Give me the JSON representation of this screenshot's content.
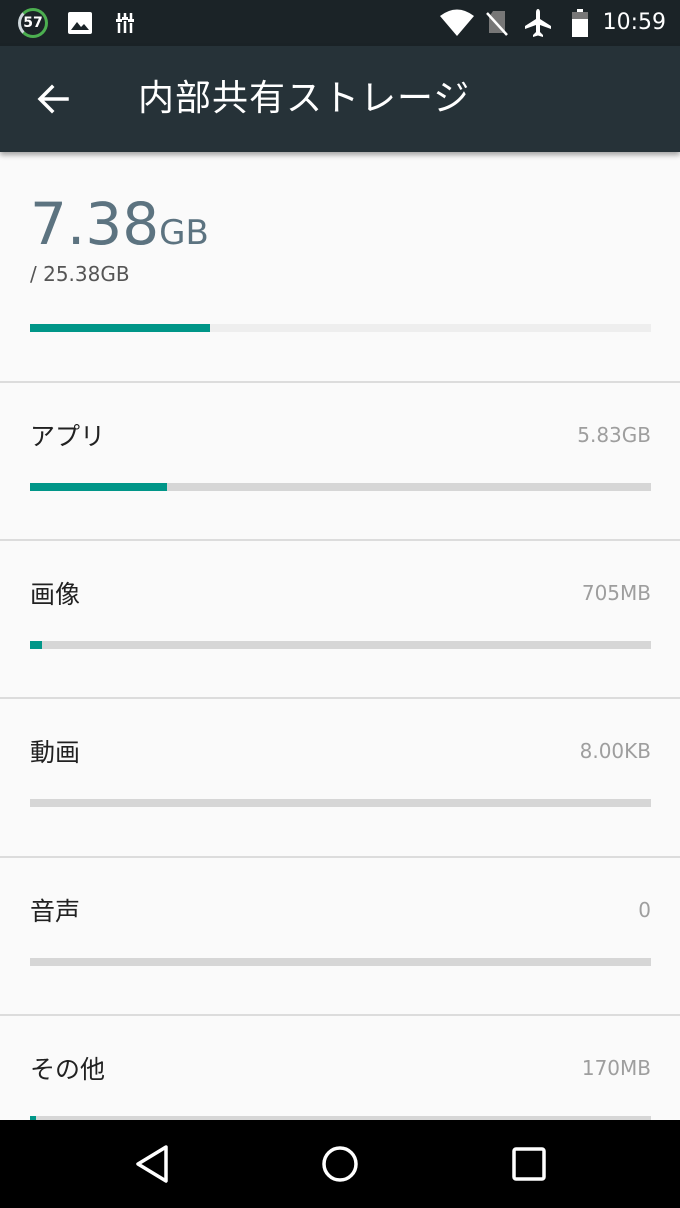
{
  "status_bar": {
    "battery_level": "57",
    "time": "10:59",
    "icons": [
      "image-notification-icon",
      "usb-debug-icon",
      "wifi-icon",
      "no-sim-icon",
      "airplane-mode-icon",
      "battery-icon"
    ]
  },
  "app_bar": {
    "title": "内部共有ストレージ"
  },
  "summary": {
    "used_value": "7.38",
    "used_unit": "GB",
    "total": "/ 25.38GB",
    "used_fraction": 0.29
  },
  "categories": [
    {
      "label": "アプリ",
      "size": "5.83GB",
      "fraction": 0.22
    },
    {
      "label": "画像",
      "size": "705MB",
      "fraction": 0.02
    },
    {
      "label": "動画",
      "size": "8.00KB",
      "fraction": 0
    },
    {
      "label": "音声",
      "size": "0",
      "fraction": 0
    },
    {
      "label": "その他",
      "size": "170MB",
      "fraction": 0.01
    }
  ],
  "colors": {
    "accent": "#009688",
    "app_bar": "#263238",
    "status_bar": "#1b2327"
  }
}
